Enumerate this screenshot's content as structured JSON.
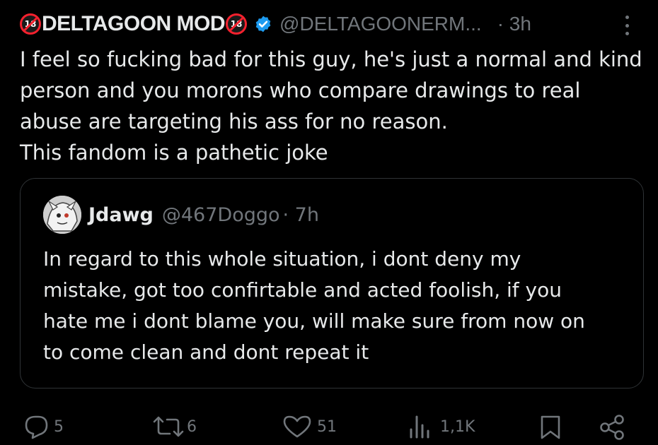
{
  "post": {
    "badge_left": "18",
    "display_name": "DELTAGOON MOD",
    "badge_right": "18",
    "handle": "@DELTAGOONERM...",
    "time": "· 3h",
    "text_lines": [
      "I feel so fucking bad for this guy, he's just a normal and kind",
      "person and you morons who compare drawings to real",
      "abuse are targeting his ass for no reason.",
      "This fandom is a pathetic joke"
    ]
  },
  "quote": {
    "name": "Jdawg",
    "handle": "@467Doggo",
    "time": "· 7h",
    "text_lines": [
      "In regard to this whole situation, i dont deny my",
      "mistake, got too confirtable and acted foolish, if you",
      "hate me i dont blame you, will make sure from now on",
      "to come clean and dont repeat it"
    ]
  },
  "actions": {
    "replies": "5",
    "reposts": "6",
    "likes": "51",
    "views": "1,1K"
  },
  "colors": {
    "background": "#000000",
    "text": "#e7e9ea",
    "muted": "#71767b",
    "verified": "#1d9bf0",
    "badge_red": "#f4212e",
    "border": "#2f3336"
  }
}
